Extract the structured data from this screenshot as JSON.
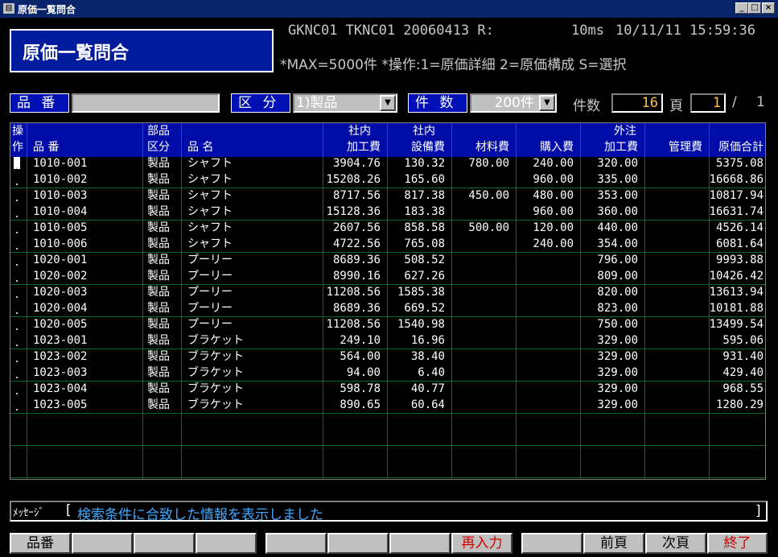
{
  "window": {
    "title": "原価一覧問合",
    "min": "_",
    "max": "□",
    "close": "×"
  },
  "header": {
    "screen_title": "原価一覧問合",
    "system_line": "GKNC01 TKNC01 20060413 R:",
    "response": "10ms",
    "datetime": "10/11/11 15:59:36",
    "hint": "*MAX=5000件 *操作:1=原価詳細 2=原価構成 S=選択"
  },
  "search": {
    "part_no_label": "品 番",
    "part_no_value": "",
    "category_label": "区 分",
    "category_value": "1)製品",
    "count_label": "件 数",
    "count_value": "200件",
    "total_label": "件数",
    "total_value": "16",
    "page_label": "頁",
    "page_value": "1",
    "page_sep": "/",
    "page_total": "1"
  },
  "table": {
    "headers": {
      "op": [
        "操",
        "作"
      ],
      "part_no": "品 番",
      "category": [
        "部品",
        "区分"
      ],
      "name": "品 名",
      "proc_cost": [
        "社内",
        "加工費"
      ],
      "equip_cost": [
        "社内",
        "設備費"
      ],
      "material": "材料費",
      "purchase": "購入費",
      "outsource": [
        "外注",
        "加工費"
      ],
      "mgmt": "管理費",
      "total": "原価合計"
    },
    "rows": [
      {
        "part_no": "1010-001",
        "category": "製品",
        "name": "シャフト",
        "proc": "3904.76",
        "equip": "130.32",
        "material": "780.00",
        "purchase": "240.00",
        "outsource": "320.00",
        "mgmt": "",
        "total": "5375.08"
      },
      {
        "part_no": "1010-002",
        "category": "製品",
        "name": "シャフト",
        "proc": "15208.26",
        "equip": "165.60",
        "material": "",
        "purchase": "960.00",
        "outsource": "335.00",
        "mgmt": "",
        "total": "16668.86"
      },
      {
        "part_no": "1010-003",
        "category": "製品",
        "name": "シャフト",
        "proc": "8717.56",
        "equip": "817.38",
        "material": "450.00",
        "purchase": "480.00",
        "outsource": "353.00",
        "mgmt": "",
        "total": "10817.94"
      },
      {
        "part_no": "1010-004",
        "category": "製品",
        "name": "シャフト",
        "proc": "15128.36",
        "equip": "183.38",
        "material": "",
        "purchase": "960.00",
        "outsource": "360.00",
        "mgmt": "",
        "total": "16631.74"
      },
      {
        "part_no": "1010-005",
        "category": "製品",
        "name": "シャフト",
        "proc": "2607.56",
        "equip": "858.58",
        "material": "500.00",
        "purchase": "120.00",
        "outsource": "440.00",
        "mgmt": "",
        "total": "4526.14"
      },
      {
        "part_no": "1010-006",
        "category": "製品",
        "name": "シャフト",
        "proc": "4722.56",
        "equip": "765.08",
        "material": "",
        "purchase": "240.00",
        "outsource": "354.00",
        "mgmt": "",
        "total": "6081.64"
      },
      {
        "part_no": "1020-001",
        "category": "製品",
        "name": "プーリー",
        "proc": "8689.36",
        "equip": "508.52",
        "material": "",
        "purchase": "",
        "outsource": "796.00",
        "mgmt": "",
        "total": "9993.88"
      },
      {
        "part_no": "1020-002",
        "category": "製品",
        "name": "プーリー",
        "proc": "8990.16",
        "equip": "627.26",
        "material": "",
        "purchase": "",
        "outsource": "809.00",
        "mgmt": "",
        "total": "10426.42"
      },
      {
        "part_no": "1020-003",
        "category": "製品",
        "name": "プーリー",
        "proc": "11208.56",
        "equip": "1585.38",
        "material": "",
        "purchase": "",
        "outsource": "820.00",
        "mgmt": "",
        "total": "13613.94"
      },
      {
        "part_no": "1020-004",
        "category": "製品",
        "name": "プーリー",
        "proc": "8689.36",
        "equip": "669.52",
        "material": "",
        "purchase": "",
        "outsource": "823.00",
        "mgmt": "",
        "total": "10181.88"
      },
      {
        "part_no": "1020-005",
        "category": "製品",
        "name": "プーリー",
        "proc": "11208.56",
        "equip": "1540.98",
        "material": "",
        "purchase": "",
        "outsource": "750.00",
        "mgmt": "",
        "total": "13499.54"
      },
      {
        "part_no": "1023-001",
        "category": "製品",
        "name": "ブラケット",
        "proc": "249.10",
        "equip": "16.96",
        "material": "",
        "purchase": "",
        "outsource": "329.00",
        "mgmt": "",
        "total": "595.06"
      },
      {
        "part_no": "1023-002",
        "category": "製品",
        "name": "ブラケット",
        "proc": "564.00",
        "equip": "38.40",
        "material": "",
        "purchase": "",
        "outsource": "329.00",
        "mgmt": "",
        "total": "931.40"
      },
      {
        "part_no": "1023-003",
        "category": "製品",
        "name": "ブラケット",
        "proc": "94.00",
        "equip": "6.40",
        "material": "",
        "purchase": "",
        "outsource": "329.00",
        "mgmt": "",
        "total": "429.40"
      },
      {
        "part_no": "1023-004",
        "category": "製品",
        "name": "ブラケット",
        "proc": "598.78",
        "equip": "40.77",
        "material": "",
        "purchase": "",
        "outsource": "329.00",
        "mgmt": "",
        "total": "968.55"
      },
      {
        "part_no": "1023-005",
        "category": "製品",
        "name": "ブラケット",
        "proc": "890.65",
        "equip": "60.64",
        "material": "",
        "purchase": "",
        "outsource": "329.00",
        "mgmt": "",
        "total": "1280.29"
      }
    ]
  },
  "message": {
    "label": "ﾒｯｾｰｼﾞ",
    "open": "[",
    "text": "検索条件に合致した情報を表示しました",
    "close": "]"
  },
  "fkeys": [
    "品番",
    "",
    "",
    "",
    "",
    "",
    "",
    "再入力",
    "",
    "前頁",
    "次頁",
    "終了"
  ]
}
